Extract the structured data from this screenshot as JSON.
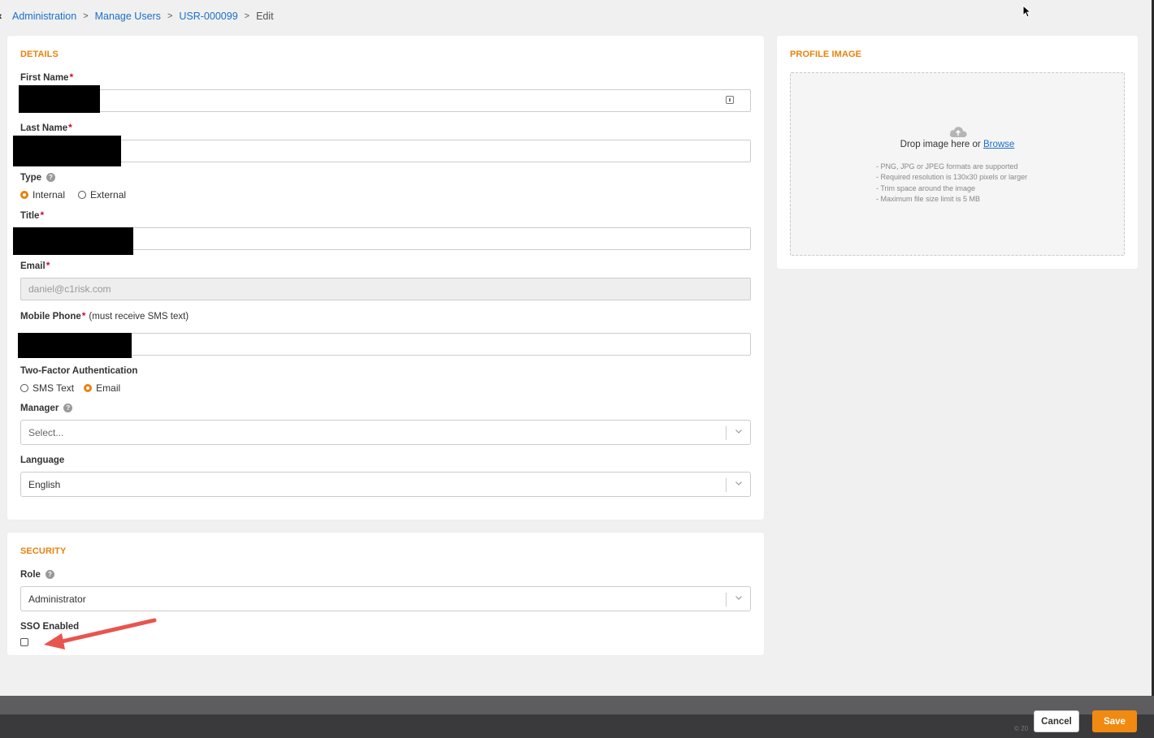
{
  "breadcrumb": {
    "back_glyph": "‹",
    "items": [
      "Administration",
      "Manage Users",
      "USR-000099"
    ],
    "current": "Edit",
    "separator": ">"
  },
  "details": {
    "title": "DETAILS",
    "first_name_label": "First Name",
    "last_name_label": "Last Name",
    "type_label": "Type",
    "type_options": [
      "Internal",
      "External"
    ],
    "type_selected": "Internal",
    "title_label": "Title",
    "email_label": "Email",
    "email_value": "daniel@c1risk.com",
    "mobile_label": "Mobile Phone",
    "mobile_note": "(must receive SMS text)",
    "tfa_label": "Two-Factor Authentication",
    "tfa_options": [
      "SMS Text",
      "Email"
    ],
    "tfa_selected": "Email",
    "manager_label": "Manager",
    "manager_placeholder": "Select...",
    "language_label": "Language",
    "language_value": "English",
    "required_marker": "*",
    "help_glyph": "?"
  },
  "security": {
    "title": "SECURITY",
    "role_label": "Role",
    "role_value": "Administrator",
    "sso_label": "SSO Enabled",
    "sso_checked": false
  },
  "profile_image": {
    "title": "PROFILE IMAGE",
    "drop_text": "Drop image here or ",
    "browse_label": "Browse",
    "hints": [
      "- PNG, JPG or JPEG formats are supported",
      "- Required resolution is 130x30 pixels or larger",
      "- Trim space around the image",
      "- Maximum file size limit is 5 MB"
    ]
  },
  "footer": {
    "cancel_label": "Cancel",
    "save_label": "Save",
    "copyright": "© 20"
  },
  "colors": {
    "accent": "#e8820c",
    "link": "#1a6fc9",
    "required": "#c8102e",
    "annotation": "#e8554e"
  },
  "icons": [
    "contact-card-icon",
    "help-icon",
    "chevron-down-icon",
    "cloud-upload-icon",
    "mouse-cursor-icon",
    "annotation-arrow"
  ]
}
